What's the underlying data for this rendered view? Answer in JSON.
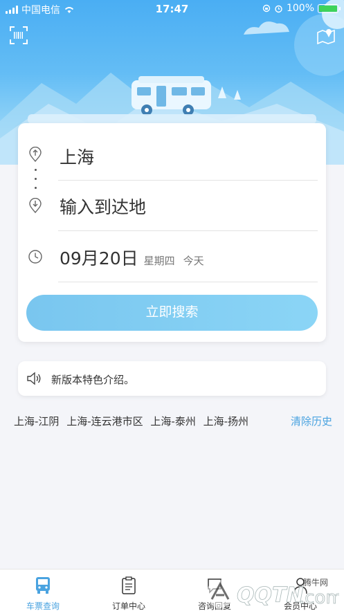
{
  "status_bar": {
    "carrier": "中国电信",
    "time": "17:47",
    "battery": "100%"
  },
  "colors": {
    "accent": "#4aa3e0",
    "header_top": "#4aaef3",
    "search_button": "#8bd5f6"
  },
  "header": {
    "left_icon": "barcode-scan-icon",
    "right_icon": "map-icon"
  },
  "search_card": {
    "origin": "上海",
    "destination_placeholder": "输入到达地",
    "date": "09月20日",
    "weekday": "星期四",
    "day_label": "今天",
    "search_button": "立即搜索"
  },
  "notice": {
    "text": "新版本特色介绍。"
  },
  "history": {
    "items": [
      "上海-江阴",
      "上海-连云港市区",
      "上海-泰州",
      "上海-扬州"
    ],
    "clear_label": "清除历史"
  },
  "tabs": [
    {
      "label": "车票查询",
      "icon": "bus-icon",
      "active": true
    },
    {
      "label": "订单中心",
      "icon": "clipboard-icon",
      "active": false
    },
    {
      "label": "咨询回复",
      "icon": "chat-icon",
      "active": false
    },
    {
      "label": "会员中心",
      "icon": "person-icon",
      "active": false
    }
  ],
  "watermark": "腾牛网"
}
